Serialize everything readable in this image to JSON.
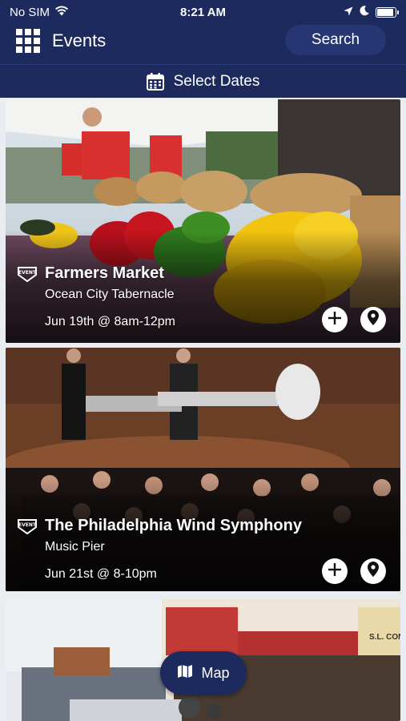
{
  "status_bar": {
    "carrier": "No SIM",
    "time": "8:21 AM",
    "battery_level": 0.9
  },
  "header": {
    "title": "Events",
    "search_label": "Search",
    "select_dates_label": "Select Dates"
  },
  "events": [
    {
      "title": "Farmers Market",
      "venue": "Ocean City Tabernacle",
      "date": "Jun 19th @ 8am-12pm"
    },
    {
      "title": "The Philadelphia Wind Symphony",
      "venue": "Music Pier",
      "date": "Jun 21st @ 8-10pm"
    }
  ],
  "third_card_sign": "S.L. CONNEC",
  "map_button": {
    "label": "Map"
  },
  "colors": {
    "header_bg": "#1d2a5e",
    "search_bg": "#263672",
    "white": "#ffffff"
  },
  "icons": [
    "grid-menu-icon",
    "calendar-icon",
    "event-badge-icon",
    "plus-icon",
    "location-pin-icon",
    "map-icon",
    "wifi-icon",
    "location-arrow-icon",
    "moon-icon",
    "battery-icon"
  ]
}
